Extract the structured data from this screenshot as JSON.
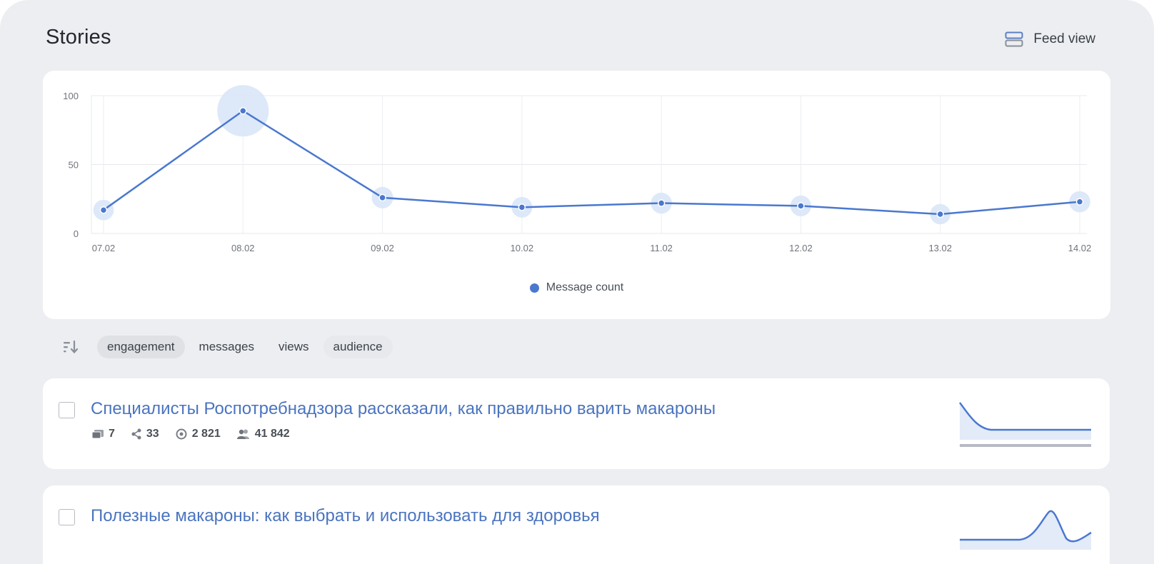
{
  "page": {
    "title": "Stories",
    "feed_view_label": "Feed view"
  },
  "chart_data": {
    "type": "line",
    "x": [
      "07.02",
      "08.02",
      "09.02",
      "10.02",
      "11.02",
      "12.02",
      "13.02",
      "14.02"
    ],
    "series": [
      {
        "name": "Message count",
        "values": [
          17,
          89,
          26,
          19,
          22,
          20,
          14,
          23
        ]
      }
    ],
    "y_ticks": [
      0,
      50,
      100
    ],
    "ylim": [
      0,
      100
    ],
    "grid": true,
    "legend": "bottom-center",
    "colors": {
      "line": "#4a78cf",
      "halo": "#d9e5f7"
    }
  },
  "sort": {
    "icon": "sort-descending-icon",
    "options": [
      {
        "label": "engagement",
        "active": true
      },
      {
        "label": "messages",
        "active": false
      },
      {
        "label": "views",
        "active": false
      },
      {
        "label": "audience",
        "active": false
      }
    ]
  },
  "stories": [
    {
      "title": "Специалисты Роспотребнадзора рассказали, как правильно варить макароны",
      "messages": "7",
      "shares": "33",
      "views": "2 821",
      "audience": "41 842"
    },
    {
      "title": "Полезные макароны: как выбрать и использовать для здоровья"
    }
  ]
}
